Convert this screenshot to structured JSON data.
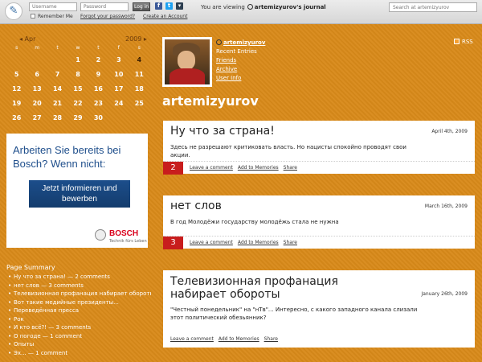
{
  "topbar": {
    "username_placeholder": "Username",
    "password_placeholder": "Password",
    "login_label": "Log in",
    "remember_label": "Remember Me",
    "forgot_label": "Forgot your password?",
    "create_label": "Create an Account",
    "viewing_prefix": "You are viewing",
    "viewing_user": "artemizyurov's journal",
    "search_placeholder": "Search at artemizyurov",
    "social": [
      {
        "icon": "facebook-icon",
        "glyph": "f",
        "color": "#3b5998"
      },
      {
        "icon": "twitter-icon",
        "glyph": "t",
        "color": "#1da1f2"
      },
      {
        "icon": "livejournal-icon",
        "glyph": "▾",
        "color": "#2c3e50"
      }
    ]
  },
  "calendar": {
    "prev_label": "◂ Apr",
    "next_label": "2009 ▸",
    "weekdays": [
      "s",
      "m",
      "t",
      "w",
      "t",
      "f",
      "s"
    ],
    "days": [
      "",
      "",
      "",
      "1",
      "2",
      "3",
      "4",
      "5",
      "6",
      "7",
      "8",
      "9",
      "10",
      "11",
      "12",
      "13",
      "14",
      "15",
      "16",
      "17",
      "18",
      "19",
      "20",
      "21",
      "22",
      "23",
      "24",
      "25",
      "26",
      "27",
      "28",
      "29",
      "30",
      "",
      ""
    ],
    "linked_days": [
      "4"
    ]
  },
  "ad": {
    "headline": "Arbeiten Sie bereits bei Bosch? Wenn nicht:",
    "button": "Jetzt informieren und bewerben",
    "brand": "BOSCH",
    "tagline": "Technik fürs Leben"
  },
  "summary": {
    "title": "Page Summary",
    "items": [
      "Ну что за страна! — 2 comments",
      "нет слов — 3 comments",
      "Телевизионная профанация набирает обороты",
      "Вот такие медийные президенты...",
      "Переведённая пресса",
      "Рок",
      "И кто всё?! — 3 comments",
      "О погоде — 1 comment",
      "Опыты",
      "Эх... — 1 comment"
    ]
  },
  "profile": {
    "username": "artemizyurov",
    "recent": "Recent Entries",
    "friends": "Friends",
    "archive": "Archive",
    "userinfo": "User Info",
    "rss": "RSS",
    "journal_title": "artemizyurov"
  },
  "posts": [
    {
      "title": "Ну что за страна!",
      "date": "April 4th, 2009",
      "body": "Здесь не разрешают критиковать власть. Но нацисты спокойно проводят свои акции.",
      "comments": "2",
      "actions": [
        "Leave a comment",
        "Add to Memories",
        "Share"
      ]
    },
    {
      "title": "нет слов",
      "date": "March 16th, 2009",
      "body": "В год Молодёжи государству молодёжь стала не нужна",
      "comments": "3",
      "actions": [
        "Leave a comment",
        "Add to Memories",
        "Share"
      ]
    },
    {
      "title": "Телевизионная профанация набирает обороты",
      "date": "January 26th, 2009",
      "body": "\"Честный понедельник\" на \"нТв\"... Интересно, с какого западного канала слизали этот политический обезьянник?",
      "comments": "",
      "actions": [
        "Leave a comment",
        "Add to Memories",
        "Share"
      ]
    }
  ]
}
